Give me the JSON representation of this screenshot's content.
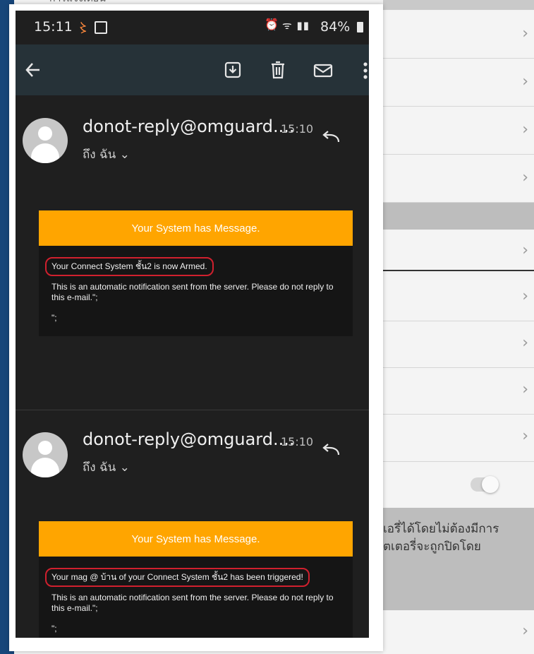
{
  "background": {
    "top_text": "การแจ้งเตือน",
    "chevron": "›",
    "thai_line_1": "เอรี่ได้โดยไม่ต้องมีการ",
    "thai_line_2": "ตเตอรี่จะถูกปิดโดย"
  },
  "status_bar": {
    "time": "15:11",
    "battery": "84%"
  },
  "emails": [
    {
      "sender": "donot-reply@omguard....",
      "time": "15:10",
      "to": "ถึง ฉัน ⌄",
      "header": "Your System has Message.",
      "highlight": "Your Connect System ชั้น2 is now Armed.",
      "notice": "This is an automatic notification sent from the server. Please do not reply to this e-mail.\";",
      "footer": "\";"
    },
    {
      "sender": "donot-reply@omguard....",
      "time": "15:10",
      "to": "ถึง ฉัน ⌄",
      "header": "Your System has Message.",
      "highlight": "Your mag @ บ้าน of your Connect System ชั้น2 has been triggered!",
      "notice": "This is an automatic notification sent from the server. Please do not reply to this e-mail.\";",
      "footer": "\";"
    }
  ],
  "colors": {
    "accent_orange": "#ffa500",
    "highlight_red": "#d0202e",
    "topbar": "#263238"
  }
}
